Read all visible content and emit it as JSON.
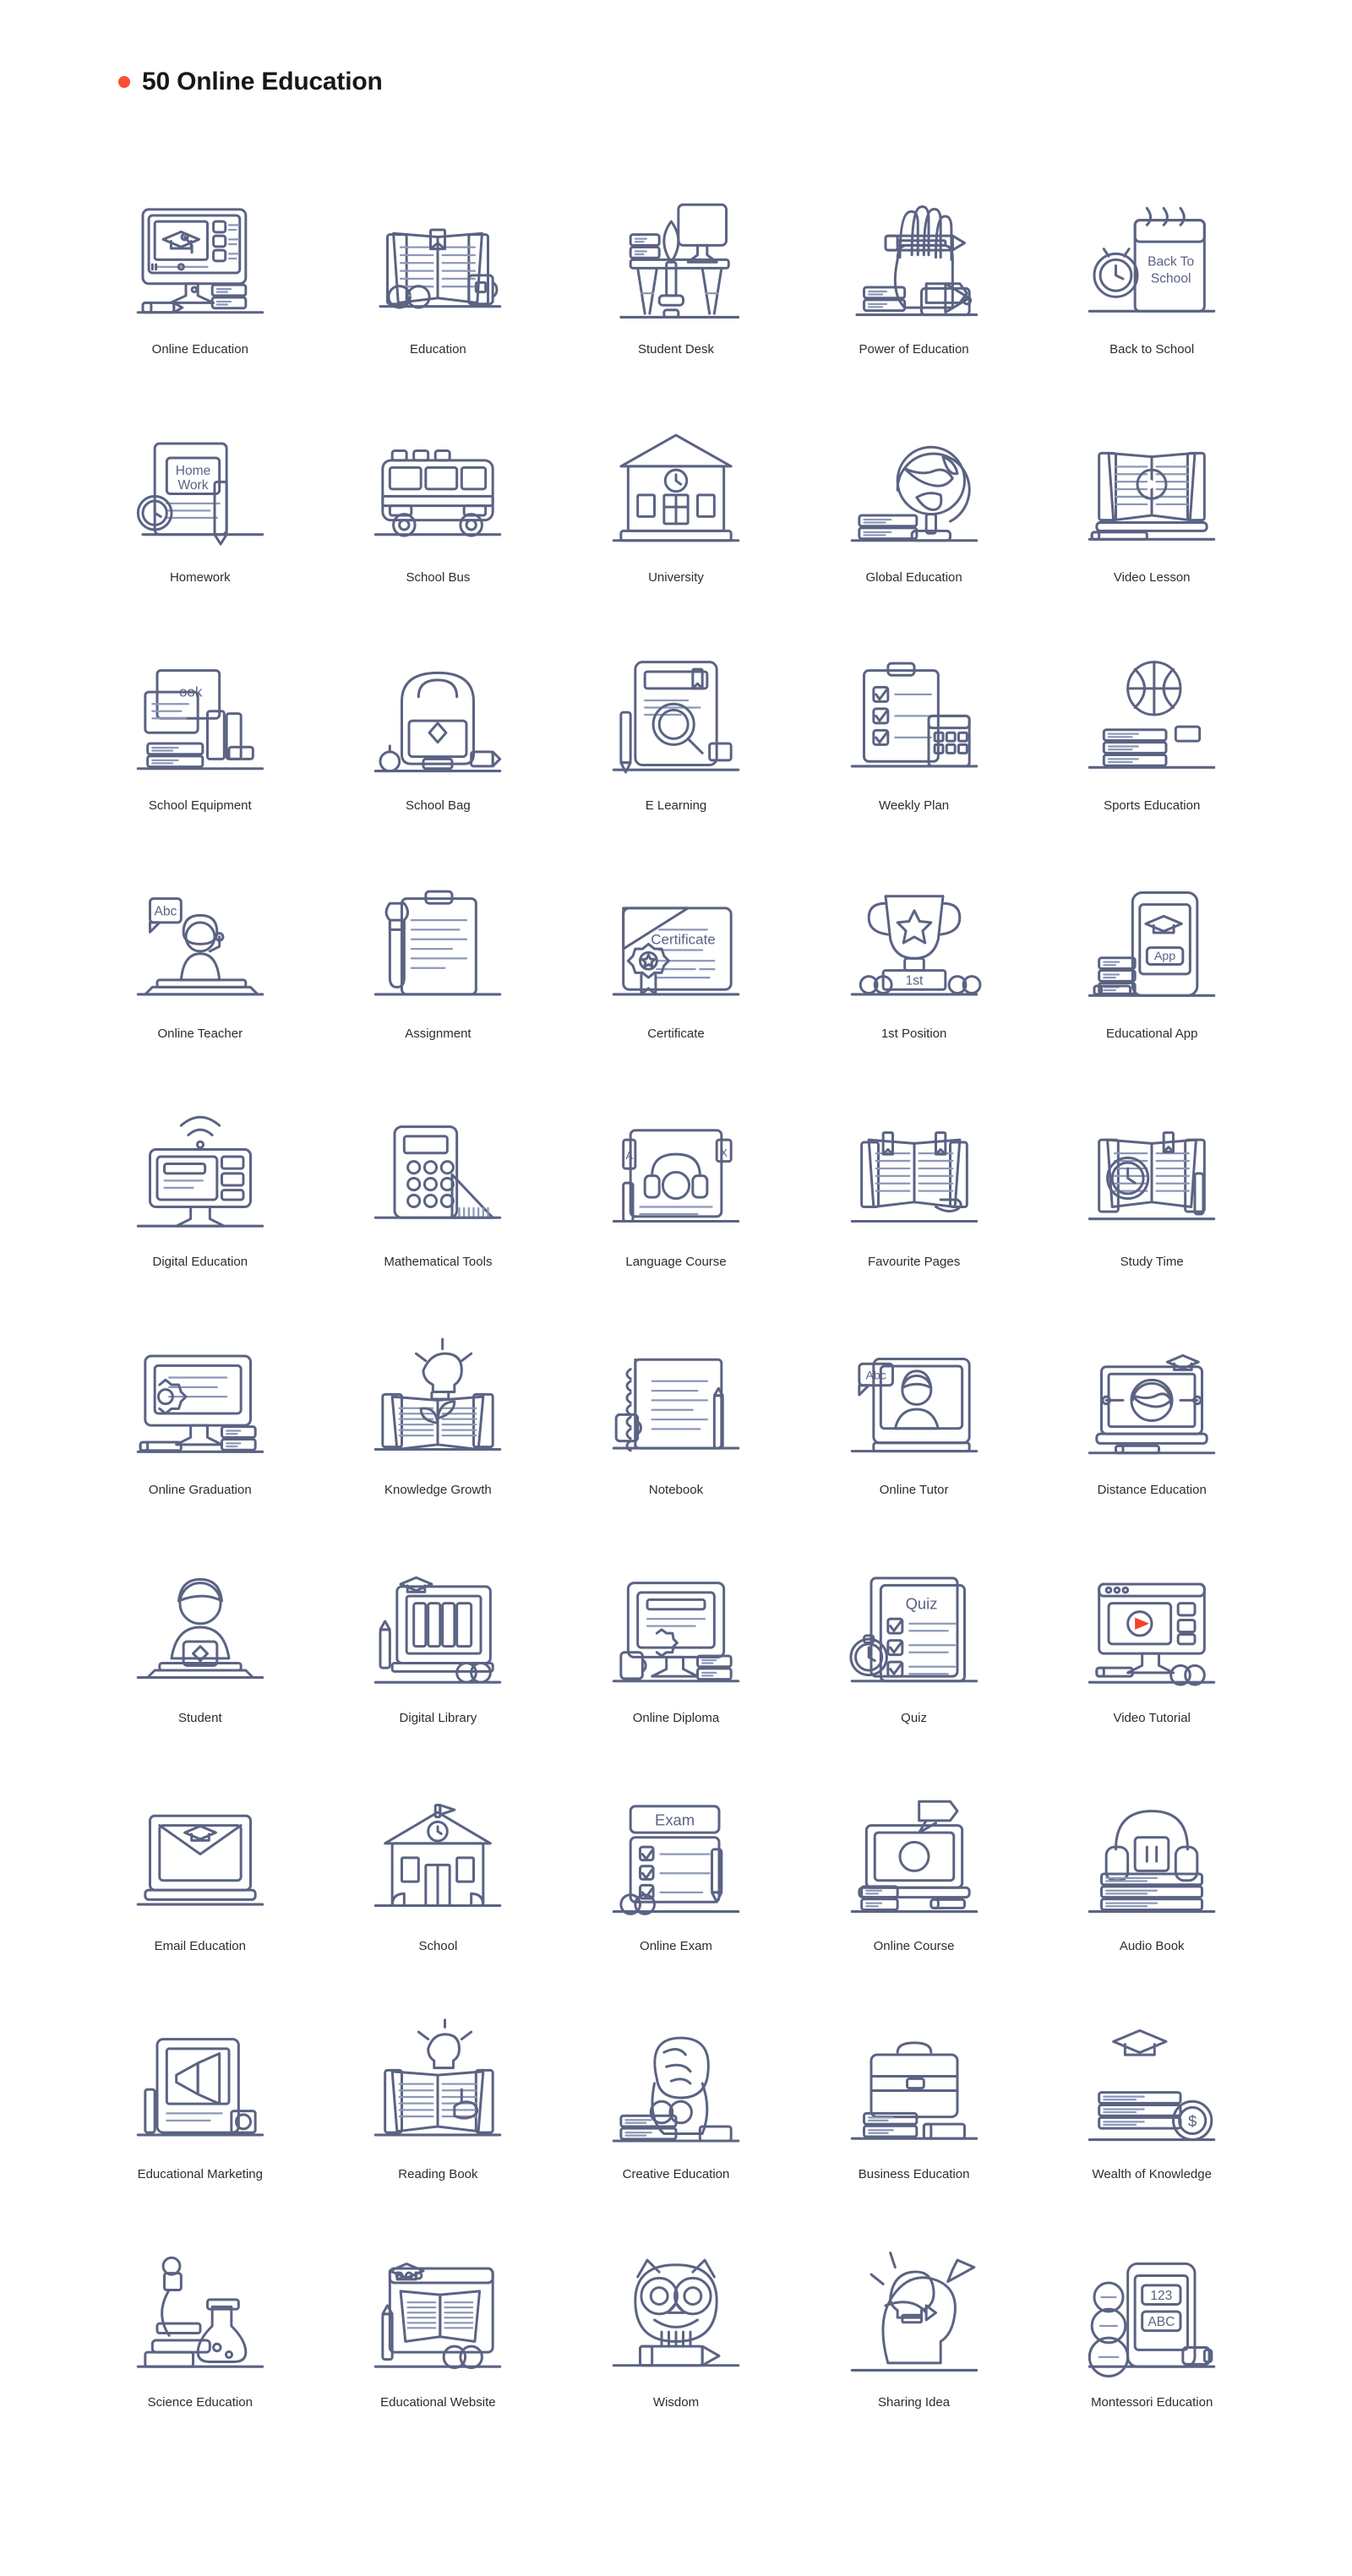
{
  "header": {
    "bullet_color": "#f94f32",
    "title": "50 Online Education"
  },
  "palette": {
    "outline": "#5b6383",
    "red": "#f4402e",
    "blue": "#3aaee8",
    "light_blue": "#d9edf8",
    "mint": "#2be5b5",
    "yellow": "#ffd84d",
    "orange": "#f79c56",
    "paper": "#f4fafd",
    "skin": "#f9cfa6",
    "text": "#2b2d33"
  },
  "grid": {
    "columns": 5,
    "rows": 10,
    "total": 50
  },
  "icons": [
    {
      "id": "online-education",
      "label": "Online Education",
      "art": "monitor-cap"
    },
    {
      "id": "education",
      "label": "Education",
      "art": "open-book-mug"
    },
    {
      "id": "student-desk",
      "label": "Student Desk",
      "art": "desk-monitor"
    },
    {
      "id": "power-of-education",
      "label": "Power of Education",
      "art": "hand-pencil"
    },
    {
      "id": "back-to-school",
      "label": "Back to School",
      "art": "calendar-clock",
      "inner_text": "Back To School"
    },
    {
      "id": "homework",
      "label": "Homework",
      "art": "homework-book",
      "inner_text": "Home Work"
    },
    {
      "id": "school-bus",
      "label": "School Bus",
      "art": "bus"
    },
    {
      "id": "university",
      "label": "University",
      "art": "university-building"
    },
    {
      "id": "global-education",
      "label": "Global Education",
      "art": "globe-books"
    },
    {
      "id": "video-lesson",
      "label": "Video Lesson",
      "art": "book-play"
    },
    {
      "id": "school-equipment",
      "label": "School Equipment",
      "art": "equipment-stack",
      "inner_text": "ook"
    },
    {
      "id": "school-bag",
      "label": "School Bag",
      "art": "backpack"
    },
    {
      "id": "e-learning",
      "label": "E Learning",
      "art": "tablet-magnifier"
    },
    {
      "id": "weekly-plan",
      "label": "Weekly Plan",
      "art": "clipboard-calendar"
    },
    {
      "id": "sports-education",
      "label": "Sports Education",
      "art": "basketball-books"
    },
    {
      "id": "online-teacher",
      "label": "Online Teacher",
      "art": "teacher-laptop",
      "inner_text": "Abc"
    },
    {
      "id": "assignment",
      "label": "Assignment",
      "art": "clipboard-pen"
    },
    {
      "id": "certificate",
      "label": "Certificate",
      "art": "certificate",
      "inner_text": "Certificate"
    },
    {
      "id": "1st-position",
      "label": "1st Position",
      "art": "trophy",
      "inner_text": "1st"
    },
    {
      "id": "educational-app",
      "label": "Educational App",
      "art": "phone-cap",
      "inner_text": "App"
    },
    {
      "id": "digital-education",
      "label": "Digital Education",
      "art": "wifi-monitor"
    },
    {
      "id": "mathematical-tools",
      "label": "Mathematical Tools",
      "art": "calculator-ruler"
    },
    {
      "id": "language-course",
      "label": "Language Course",
      "art": "headphones-book",
      "inner_text": "A | X"
    },
    {
      "id": "favourite-pages",
      "label": "Favourite Pages",
      "art": "book-bookmarks"
    },
    {
      "id": "study-time",
      "label": "Study Time",
      "art": "book-clock"
    },
    {
      "id": "online-graduation",
      "label": "Online Graduation",
      "art": "monitor-badge"
    },
    {
      "id": "knowledge-growth",
      "label": "Knowledge Growth",
      "art": "book-plant-bulb"
    },
    {
      "id": "notebook",
      "label": "Notebook",
      "art": "notebook-mug"
    },
    {
      "id": "online-tutor",
      "label": "Online Tutor",
      "art": "tutor-screen",
      "inner_text": "Abc"
    },
    {
      "id": "distance-education",
      "label": "Distance Education",
      "art": "laptop-globe-cap"
    },
    {
      "id": "student",
      "label": "Student",
      "art": "student-laptop"
    },
    {
      "id": "digital-library",
      "label": "Digital Library",
      "art": "library-screen"
    },
    {
      "id": "online-diploma",
      "label": "Online Diploma",
      "art": "diploma-monitor"
    },
    {
      "id": "quiz",
      "label": "Quiz",
      "art": "quiz-sheet",
      "inner_text": "Quiz"
    },
    {
      "id": "video-tutorial",
      "label": "Video Tutorial",
      "art": "video-monitor"
    },
    {
      "id": "email-education",
      "label": "Email Education",
      "art": "laptop-envelope"
    },
    {
      "id": "school",
      "label": "School",
      "art": "school-building"
    },
    {
      "id": "online-exam",
      "label": "Online Exam",
      "art": "exam-sheet",
      "inner_text": "Exam"
    },
    {
      "id": "online-course",
      "label": "Online Course",
      "art": "course-laptop"
    },
    {
      "id": "audio-book",
      "label": "Audio Book",
      "art": "headphones-books"
    },
    {
      "id": "educational-marketing",
      "label": "Educational Marketing",
      "art": "tablet-megaphone"
    },
    {
      "id": "reading-book",
      "label": "Reading Book",
      "art": "book-hand-bulb"
    },
    {
      "id": "creative-education",
      "label": "Creative Education",
      "art": "brain-head-books"
    },
    {
      "id": "business-education",
      "label": "Business Education",
      "art": "briefcase-books"
    },
    {
      "id": "wealth-of-knowledge",
      "label": "Wealth of Knowledge",
      "art": "books-cap-coin"
    },
    {
      "id": "science-education",
      "label": "Science Education",
      "art": "microscope-flask"
    },
    {
      "id": "educational-website",
      "label": "Educational Website",
      "art": "website-book-cap"
    },
    {
      "id": "wisdom",
      "label": "Wisdom",
      "art": "owl-pencil"
    },
    {
      "id": "sharing-idea",
      "label": "Sharing Idea",
      "art": "head-bulb-plane"
    },
    {
      "id": "montessori-education",
      "label": "Montessori Education",
      "art": "phone-blocks",
      "inner_text": "123 ABC"
    }
  ]
}
